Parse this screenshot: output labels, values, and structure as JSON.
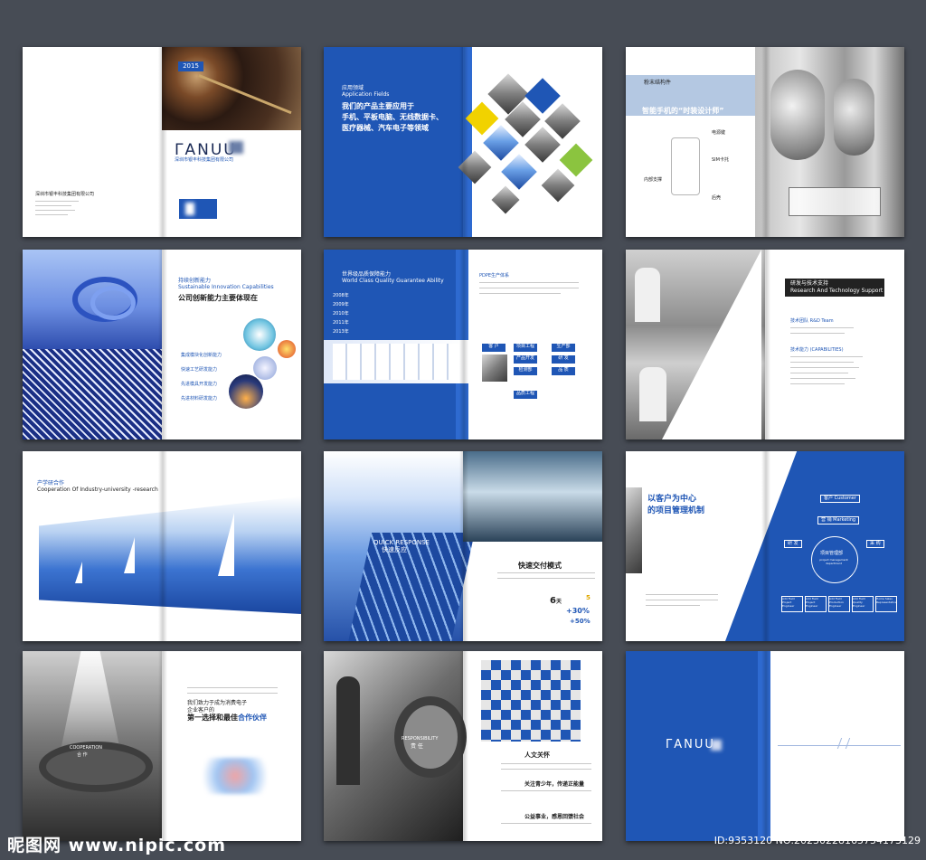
{
  "watermark": {
    "left": "昵图网 www.nipic.com",
    "right": "ID:9353120 NO:20230228165754173129"
  },
  "spread1": {
    "year": "2015",
    "logo": "ΓANUU",
    "company_sub": "深圳市银丰科技集团有限公司",
    "company": "深圳市银丰科技集团有限公司"
  },
  "spread2": {
    "label_cn": "应用领域",
    "label_en": "Application Fields",
    "headline": [
      "我们的产品主要应用于",
      "手机、平板电脑、无线数据卡、",
      "医疗器械、汽车电子等领域"
    ]
  },
  "spread3": {
    "label": "粉末结构件",
    "headline": "智能手机的“时装设计师”",
    "callouts": [
      "电源键",
      "SIM卡托",
      "内部支撑",
      "后壳"
    ]
  },
  "spread4": {
    "label_cn": "持续创新能力",
    "label_en": "Sustainable Innovation Capabilities",
    "headline": "公司创新能力主要体现在",
    "bullets": [
      "集成模块化创新能力",
      "快速工艺研发能力",
      "先进模具开发能力",
      "先进材料研发能力"
    ]
  },
  "spread5": {
    "label_cn": "世界级品质保障能力",
    "label_en": "World Class Quality Guarantee Ability",
    "timeline": [
      "2008年",
      "2009年",
      "2010年",
      "2011年",
      "2013年"
    ],
    "flow": [
      "客 户",
      "项目工程",
      "产品开发",
      "检测部",
      "品质工程",
      "研 发",
      "品 质",
      "生产部"
    ],
    "right_title": "PDPE生产体系"
  },
  "spread6": {
    "label_cn": "研发与技术支持",
    "label_en": "Research And Technology Support",
    "section1": "技术团队 R&D Team",
    "section2": "技术能力 (CAPABILITIES)"
  },
  "spread7": {
    "label_cn": "产学研合作",
    "label_en": "Cooperation Of Industry-university -research"
  },
  "spread8": {
    "photo_en": "QUICK RESPONSE",
    "photo_cn": "快速反应",
    "headline": "快速交付模式",
    "stat_days": "6",
    "stat_days_unit": "天",
    "stat_small": "5",
    "stat_up1": "+30%",
    "stat_up2": "+50%"
  },
  "spread9": {
    "headline": [
      "以客户为中心",
      "的项目管理机制"
    ],
    "center_cn": "项目管理部",
    "center_en": "project management department",
    "top_node": "客户 Customer",
    "mid_node": "营 销 Marketing",
    "side_left": "研 发",
    "side_right": "采 购",
    "bottom_nodes": [
      "Add Field Project Engineer",
      "Add Field Project Engineer",
      "Add Field Production Engineer",
      "Add Field Quality Engineer",
      "Home Sales Representative"
    ]
  },
  "spread10": {
    "lead": "我们致力于成为消费电子",
    "lead2": "企业客户的",
    "headline_a": "第一选择和最佳",
    "headline_b": "合作伙伴",
    "building_en": "COOPERATION",
    "building_cn": "合 作"
  },
  "spread11": {
    "photo_en": "RESPONSIBILITY",
    "photo_cn": "责 任",
    "care": "人文关怀",
    "youth": "关注青少年，传递正能量",
    "public": "公益事业，感恩回馈社会"
  },
  "spread12": {
    "logo": "ΓANUU"
  }
}
